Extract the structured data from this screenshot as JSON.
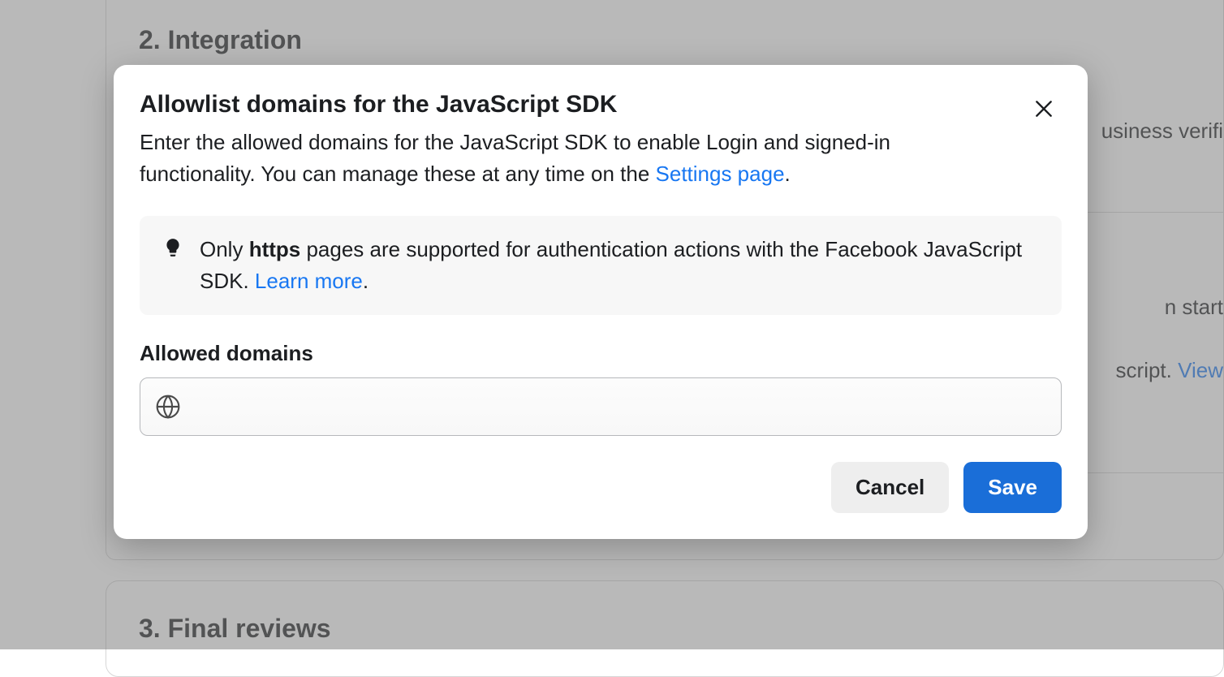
{
  "background": {
    "section2_heading": "2. Integration",
    "section3_heading": "3. Final reviews",
    "snippet_verif": "usiness verifi",
    "snippet_start": "n start",
    "snippet_script": "script. ",
    "snippet_view": "View"
  },
  "modal": {
    "title": "Allowlist domains for the JavaScript SDK",
    "subtitle_before": "Enter the allowed domains for the JavaScript SDK to enable Login and signed-in functionality. You can manage these at any time on the ",
    "subtitle_link": "Settings page",
    "subtitle_after": ".",
    "info_before": "Only ",
    "info_bold": "https",
    "info_middle": " pages are supported for authentication actions with the Facebook JavaScript SDK. ",
    "info_link": "Learn more",
    "info_after": ".",
    "field_label": "Allowed domains",
    "input_value": "",
    "cancel_label": "Cancel",
    "save_label": "Save"
  }
}
